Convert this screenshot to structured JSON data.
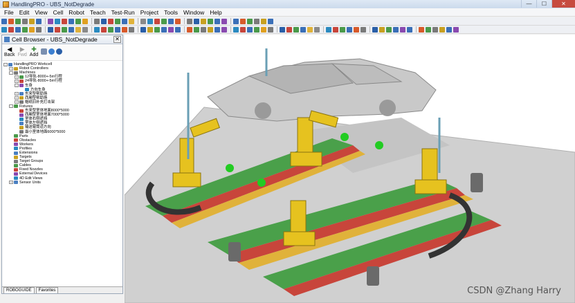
{
  "window": {
    "title": "HandlingPRO - UBS_NotDegrade",
    "minimize_glyph": "—",
    "maximize_glyph": "☐",
    "close_glyph": "✕"
  },
  "menu": [
    "File",
    "Edit",
    "View",
    "Cell",
    "Robot",
    "Teach",
    "Test-Run",
    "Project",
    "Tools",
    "Window",
    "Help"
  ],
  "cell_browser": {
    "title": "Cell Browser - UBS_NotDegrade",
    "close_glyph": "✕",
    "nav": {
      "back_label": "Back",
      "back_glyph": "◀",
      "fwd_label": "Fwd",
      "fwd_glyph": "▶",
      "add_label": "Add",
      "add_glyph": "✚"
    },
    "tree": [
      {
        "label": "HandlingPRO Workcell",
        "indent": 0,
        "exp": "-"
      },
      {
        "label": "Robot Controllers",
        "indent": 1,
        "exp": "+"
      },
      {
        "label": "Machines",
        "indent": 1,
        "exp": "-"
      },
      {
        "label": "12导轨-8000+-5m行程",
        "indent": 2,
        "exp": "+"
      },
      {
        "label": "24导轨-8000+-5m行程",
        "indent": 2,
        "exp": "+"
      },
      {
        "label": "车身",
        "indent": 2,
        "exp": "-"
      },
      {
        "label": "方向车身",
        "indent": 3,
        "exp": ""
      },
      {
        "label": "东来型帮助扬",
        "indent": 2,
        "exp": "+"
      },
      {
        "label": "西厢型帮助扬",
        "indent": 2,
        "exp": "+"
      },
      {
        "label": "帽纸旧补充打击架",
        "indent": 2,
        "exp": "+"
      },
      {
        "label": "Fixtures",
        "indent": 1,
        "exp": "-"
      },
      {
        "label": "东来型室体地面8000*5000",
        "indent": 2,
        "exp": ""
      },
      {
        "label": "西厢型室体地面7000*5000",
        "indent": 2,
        "exp": ""
      },
      {
        "label": "室体右侧遮挡",
        "indent": 2,
        "exp": ""
      },
      {
        "label": "室体左侧遮挡",
        "indent": 2,
        "exp": ""
      },
      {
        "label": "输送辊筒道方向",
        "indent": 2,
        "exp": ""
      },
      {
        "label": "最小室体地面6000*5000",
        "indent": 2,
        "exp": ""
      },
      {
        "label": "Parts",
        "indent": 1,
        "exp": ""
      },
      {
        "label": "Obstacles",
        "indent": 1,
        "exp": ""
      },
      {
        "label": "Workers",
        "indent": 1,
        "exp": ""
      },
      {
        "label": "Profiles",
        "indent": 1,
        "exp": ""
      },
      {
        "label": "Extensions",
        "indent": 1,
        "exp": ""
      },
      {
        "label": "Targets",
        "indent": 1,
        "exp": ""
      },
      {
        "label": "Target Groups",
        "indent": 1,
        "exp": ""
      },
      {
        "label": "Cables",
        "indent": 1,
        "exp": ""
      },
      {
        "label": "Fixed Nozzles",
        "indent": 1,
        "exp": ""
      },
      {
        "label": "External Devices",
        "indent": 1,
        "exp": ""
      },
      {
        "label": "4D Edit Views",
        "indent": 1,
        "exp": ""
      },
      {
        "label": "Sensor Units",
        "indent": 1,
        "exp": "+"
      }
    ],
    "tabs": [
      "ROBOGUIDE",
      "Favorites"
    ]
  },
  "watermark": "CSDN @Zhang Harry",
  "colors": {
    "floor": "#d3d3d3",
    "rail_red": "#c8453b",
    "rail_green": "#4aa04a",
    "robot_yellow": "#e6c21f",
    "target_green": "#22cc22",
    "body_gray": "#c9c9c9"
  }
}
